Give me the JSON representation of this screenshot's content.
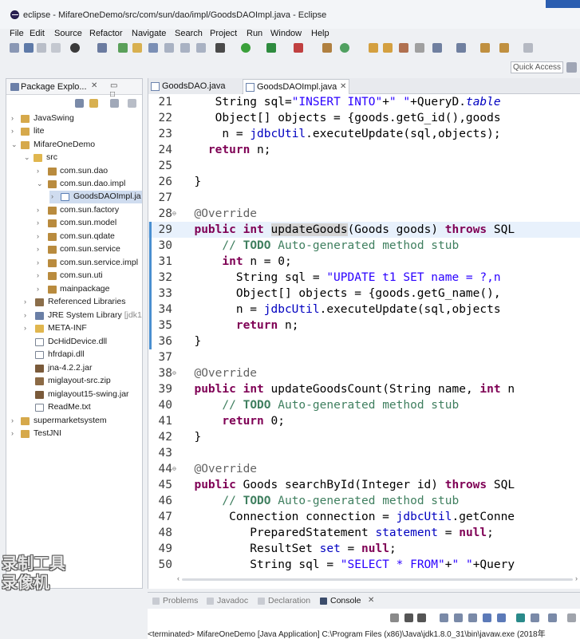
{
  "window": {
    "title": "eclipse - MifareOneDemo/src/com/sun/dao/impl/GoodsDAOImpl.java - Eclipse"
  },
  "menu": [
    "File",
    "Edit",
    "Source",
    "Refactor",
    "Navigate",
    "Search",
    "Project",
    "Run",
    "Window",
    "Help"
  ],
  "quick_access": {
    "placeholder": "Quick Access"
  },
  "package_explorer": {
    "tab_label": "Package Explo...",
    "items": [
      {
        "label": "JavaSwing",
        "icon": "project-icon"
      },
      {
        "label": "lite",
        "icon": "project-icon"
      },
      {
        "label": "MifareOneDemo",
        "icon": "project-icon"
      },
      {
        "label": "src",
        "icon": "source-folder-icon"
      },
      {
        "label": "com.sun.dao",
        "icon": "package-icon"
      },
      {
        "label": "com.sun.dao.impl",
        "icon": "package-icon"
      },
      {
        "label": "GoodsDAOImpl.ja",
        "icon": "java-file-icon"
      },
      {
        "label": "com.sun.factory",
        "icon": "package-icon"
      },
      {
        "label": "com.sun.model",
        "icon": "package-icon"
      },
      {
        "label": "com.sun.qdate",
        "icon": "package-icon"
      },
      {
        "label": "com.sun.service",
        "icon": "package-icon"
      },
      {
        "label": "com.sun.service.impl",
        "icon": "package-icon"
      },
      {
        "label": "com.sun.uti",
        "icon": "package-icon"
      },
      {
        "label": "mainpackage",
        "icon": "package-icon"
      },
      {
        "label": "Referenced Libraries",
        "icon": "library-icon"
      },
      {
        "label": "JRE System Library",
        "decoration": "[jdk1",
        "icon": "jre-library-icon"
      },
      {
        "label": "META-INF",
        "icon": "folder-icon"
      },
      {
        "label": "DcHidDevice.dll",
        "icon": "file-icon"
      },
      {
        "label": "hfrdapi.dll",
        "icon": "file-icon"
      },
      {
        "label": "jna-4.2.2.jar",
        "icon": "jar-icon"
      },
      {
        "label": "miglayout-src.zip",
        "icon": "zip-icon"
      },
      {
        "label": "miglayout15-swing.jar",
        "icon": "jar-icon"
      },
      {
        "label": "ReadMe.txt",
        "icon": "text-file-icon"
      },
      {
        "label": "supermarketsystem",
        "icon": "project-icon"
      },
      {
        "label": "TestJNI",
        "icon": "project-icon"
      }
    ]
  },
  "editor": {
    "tabs": [
      {
        "label": "GoodsDAO.java"
      },
      {
        "label": "GoodsDAOImpl.java"
      }
    ],
    "lines": [
      {
        "n": "21",
        "html": "     String sql=<span class=\"str\">\"INSERT INTO\"</span>+<span class=\"str\">\" \"</span>+QueryD.<span class=\"fld it\">table</span>"
      },
      {
        "n": "22",
        "html": "     Object[] objects = {goods.getG_id(),goods"
      },
      {
        "n": "23",
        "html": "      n = <span class=\"fld\">jdbcUtil</span>.executeUpdate(sql,objects);"
      },
      {
        "n": "24",
        "html": "    <span class=\"kw\">return</span> n;"
      },
      {
        "n": "25",
        "html": ""
      },
      {
        "n": "26",
        "html": "  }"
      },
      {
        "n": "27",
        "html": ""
      },
      {
        "n": "28",
        "html": "  <span class=\"ann\">@Override</span>"
      },
      {
        "n": "29",
        "html": "  <span class=\"kw\">public</span> <span class=\"kw\">int</span> <span style=\"background:#d4d4d4\">updateGoods</span>(Goods goods) <span class=\"kw\">throws</span> SQL"
      },
      {
        "n": "30",
        "html": "      <span class=\"cmt\">// <b>TODO</b> Auto-generated method stub</span>"
      },
      {
        "n": "31",
        "html": "      <span class=\"kw\">int</span> n = 0;"
      },
      {
        "n": "32",
        "html": "        String sql = <span class=\"str\">\"UPDATE t1 SET name = ?,n</span>"
      },
      {
        "n": "33",
        "html": "        Object[] objects = {goods.getG_name(),"
      },
      {
        "n": "34",
        "html": "        n = <span class=\"fld\">jdbcUtil</span>.executeUpdate(sql,objects"
      },
      {
        "n": "35",
        "html": "        <span class=\"kw\">return</span> n;"
      },
      {
        "n": "36",
        "html": "  }"
      },
      {
        "n": "37",
        "html": ""
      },
      {
        "n": "38",
        "html": "  <span class=\"ann\">@Override</span>"
      },
      {
        "n": "39",
        "html": "  <span class=\"kw\">public</span> <span class=\"kw\">int</span> updateGoodsCount(String name, <span class=\"kw\">int</span> n"
      },
      {
        "n": "40",
        "html": "      <span class=\"cmt\">// <b>TODO</b> Auto-generated method stub</span>"
      },
      {
        "n": "41",
        "html": "      <span class=\"kw\">return</span> 0;"
      },
      {
        "n": "42",
        "html": "  }"
      },
      {
        "n": "43",
        "html": ""
      },
      {
        "n": "44",
        "html": "  <span class=\"ann\">@Override</span>"
      },
      {
        "n": "45",
        "html": "  <span class=\"kw\">public</span> Goods searchById(Integer id) <span class=\"kw\">throws</span> SQL"
      },
      {
        "n": "46",
        "html": "      <span class=\"cmt\">// <b>TODO</b> Auto-generated method stub</span>"
      },
      {
        "n": "47",
        "html": "       Connection connection = <span class=\"fld\">jdbcUtil</span>.getConne"
      },
      {
        "n": "48",
        "html": "          PreparedStatement <span class=\"fld\">statement</span> = <span class=\"kw\">null</span>;"
      },
      {
        "n": "49",
        "html": "          ResultSet <span class=\"fld\">set</span> = <span class=\"kw\">null</span>;"
      },
      {
        "n": "50",
        "html": "          String sql = <span class=\"str\">\"SELECT * FROM\"</span>+<span class=\"str\">\" \"</span>+Query"
      }
    ]
  },
  "bottom": {
    "tabs": [
      "Problems",
      "Javadoc",
      "Declaration",
      "Console"
    ],
    "console_status": "<terminated> MifareOneDemo [Java Application] C:\\Program Files (x86)\\Java\\jdk1.8.0_31\\bin\\javaw.exe (2018年"
  },
  "watermark": {
    "line1": "录制工具",
    "line2": "录像机"
  }
}
